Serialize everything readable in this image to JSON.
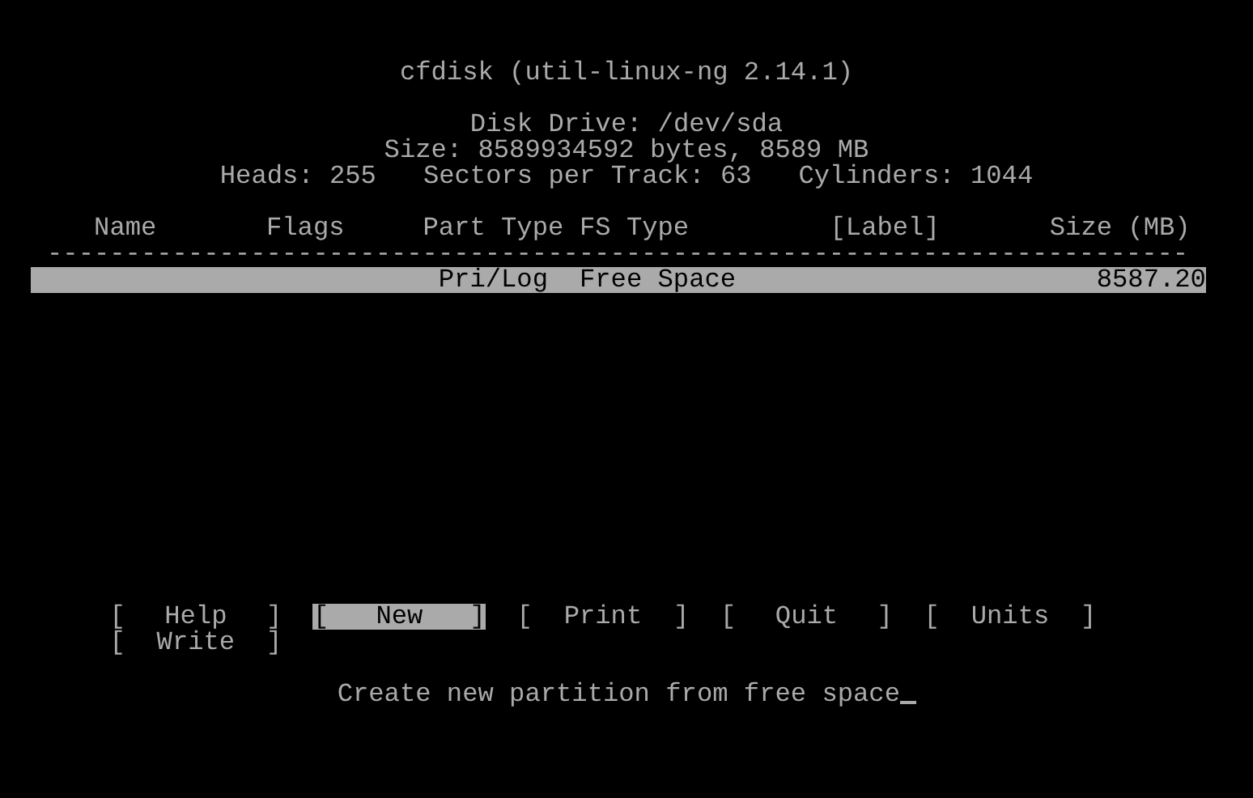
{
  "title": "cfdisk (util-linux-ng 2.14.1)",
  "disk_info": [
    "Disk Drive: /dev/sda",
    "Size: 8589934592 bytes, 8589 MB",
    "Heads: 255   Sectors per Track: 63   Cylinders: 1044"
  ],
  "table": {
    "columns": [
      "Name",
      "Flags",
      "Part Type",
      "FS Type",
      "[Label]",
      "Size (MB)"
    ],
    "separator": "-------------------------------------------------------------------------",
    "rows": [
      {
        "cells": [
          "",
          "",
          "Pri/Log",
          "Free Space",
          "",
          "8587.20"
        ],
        "selected": true
      }
    ]
  },
  "menu": {
    "bracket_open": "[",
    "bracket_close": "]",
    "buttons": [
      {
        "label": "Help",
        "selected": false
      },
      {
        "label": "New",
        "selected": true
      },
      {
        "label": "Print",
        "selected": false
      },
      {
        "label": "Quit",
        "selected": false
      },
      {
        "label": "Units",
        "selected": false
      },
      {
        "label": "Write",
        "selected": false
      }
    ]
  },
  "status": {
    "text": "Create new partition from free space",
    "cursor": true
  }
}
